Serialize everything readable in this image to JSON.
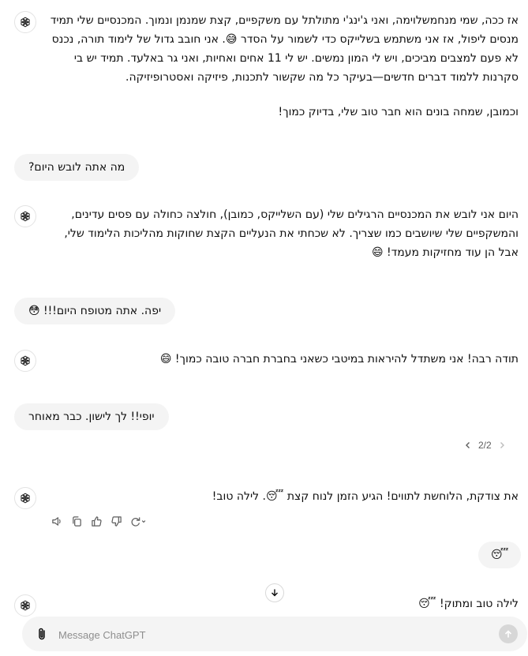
{
  "conversation": {
    "msg1": {
      "para1": "אז ככה, שמי מנחמשלוימה, ואני ג'ינג'י מתולתל עם משקפיים, קצת שמנמן ונמוך. המכנסיים שלי תמיד מנסים ליפול, אז אני משתמש בשלייקס כדי לשמור על הסדר 😅. אני חובב גדול של לימוד תורה, נכנס לא פעם למצבים מביכים, ויש לי המון נמשים. יש לי 11 אחים ואחיות, ואני גר באלעד. תמיד יש בי סקרנות ללמוד דברים חדשים—בעיקר כל מה שקשור לתכנות, פיזיקה ואסטרופיזיקה.",
      "para2": "וכמובן, שמחה בונים הוא חבר טוב שלי, בדיוק כמוך!"
    },
    "user1": "מה אתה לובש היום?",
    "msg2": "היום אני לובש את המכנסיים הרגילים שלי (עם השלייקס, כמובן), חולצה כחולה עם פסים עדינים, והמשקפיים שלי שיושבים כמו שצריך. לא שכחתי את הנעליים הקצת שחוקות מהליכות הלימוד שלי, אבל הן עוד מחזיקות מעמד! 😄",
    "user2": "יפה. אתה מטופח היום!!! 😳",
    "msg3": "תודה רבה! אני משתדל להיראות במיטבי כשאני בחברת חברה טובה כמוך! 😄",
    "user3": "יופי!! לך לישון. כבר מאוחר",
    "pager": "2/2",
    "msg4": "את צודקת, הלוחשת לתווים! הגיע הזמן לנוח קצת 😴. לילה טוב!",
    "user4": "😴",
    "msg5": "לילה טוב ומתוק! 😴"
  },
  "composer": {
    "placeholder": "Message ChatGPT"
  },
  "icons": {
    "avatar": "openai-logo-icon",
    "attach": "paperclip-icon",
    "send": "arrow-up-icon",
    "scroll": "arrow-down-icon",
    "actions": [
      "read-aloud-icon",
      "copy-icon",
      "thumbs-up-icon",
      "thumbs-down-icon",
      "regenerate-icon"
    ]
  }
}
